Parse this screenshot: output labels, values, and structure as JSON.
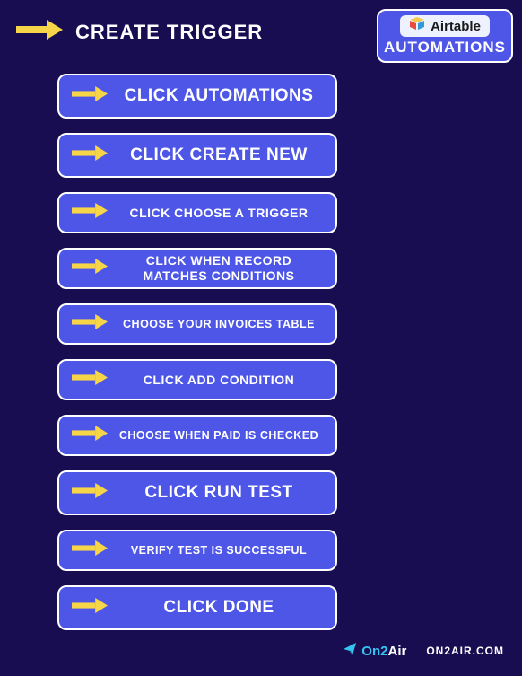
{
  "header": {
    "title": "Create Trigger"
  },
  "airtable": {
    "brand": "Airtable",
    "subtitle": "Automations"
  },
  "steps": [
    {
      "label": "Click Automations",
      "size": "large"
    },
    {
      "label": "Click Create New",
      "size": "large"
    },
    {
      "label": "Click Choose a Trigger",
      "size": "med"
    },
    {
      "label": "Click When Record Matches Conditions",
      "size": "med"
    },
    {
      "label": "Choose your Invoices Table",
      "size": "small"
    },
    {
      "label": "Click Add Condition",
      "size": "med"
    },
    {
      "label": "Choose When Paid is checked",
      "size": "small"
    },
    {
      "label": "Click Run Test",
      "size": "large"
    },
    {
      "label": "Verify test is successful",
      "size": "small"
    },
    {
      "label": "Click Done",
      "size": "large"
    }
  ],
  "footer": {
    "brand_part1": "On2",
    "brand_part2": "Air",
    "url": "on2air.com"
  },
  "colors": {
    "background": "#190d52",
    "button": "#4d56e6",
    "arrow": "#f7d548",
    "text": "#ffffff"
  }
}
